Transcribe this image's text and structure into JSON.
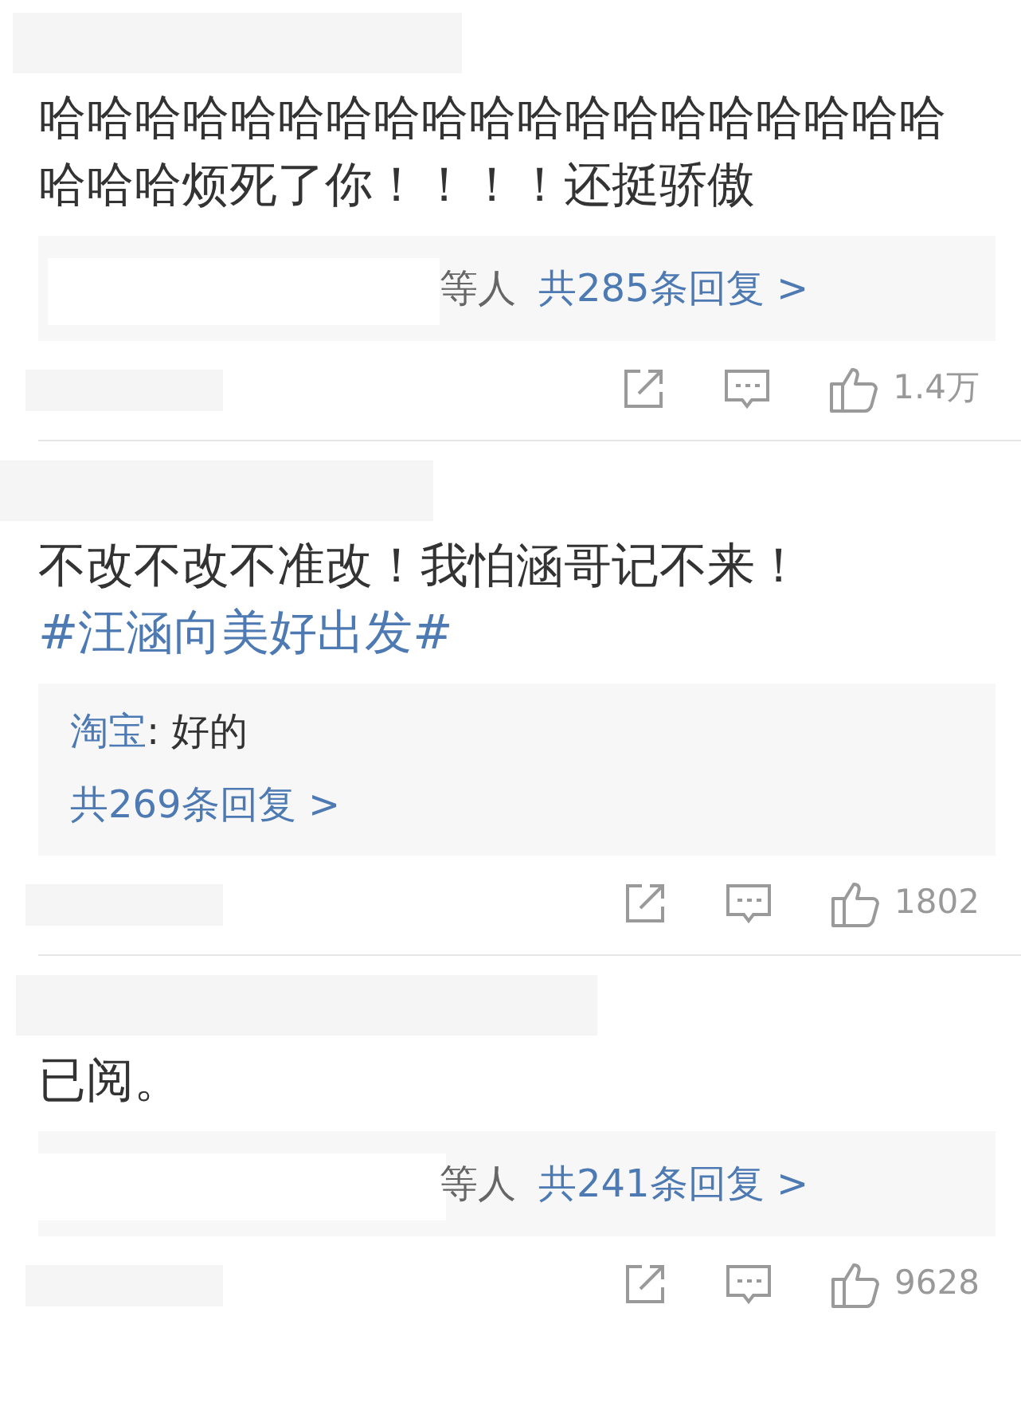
{
  "comments": [
    {
      "body": [
        {
          "kind": "plain",
          "text": "哈哈哈哈哈哈哈哈哈哈哈哈哈哈哈哈哈哈哈哈哈哈烦死了你！！！！还挺骄傲"
        }
      ],
      "replies": {
        "kind": "summary",
        "suffix": "等人",
        "link": "共285条回复 >"
      },
      "likes": "1.4万"
    },
    {
      "body": [
        {
          "kind": "plain",
          "text": "不改不改不准改！我怕涵哥记不来！"
        },
        {
          "kind": "topic",
          "text": "#汪涵向美好出发#"
        }
      ],
      "replies": {
        "kind": "preview",
        "items": [
          {
            "author": "淘宝",
            "text": ": 好的"
          }
        ],
        "link": "共269条回复 >"
      },
      "likes": "1802"
    },
    {
      "body": [
        {
          "kind": "plain",
          "text": "已阅。"
        }
      ],
      "replies": {
        "kind": "summary",
        "suffix": "等人",
        "link": "共241条回复 >"
      },
      "likes": "9628"
    }
  ]
}
